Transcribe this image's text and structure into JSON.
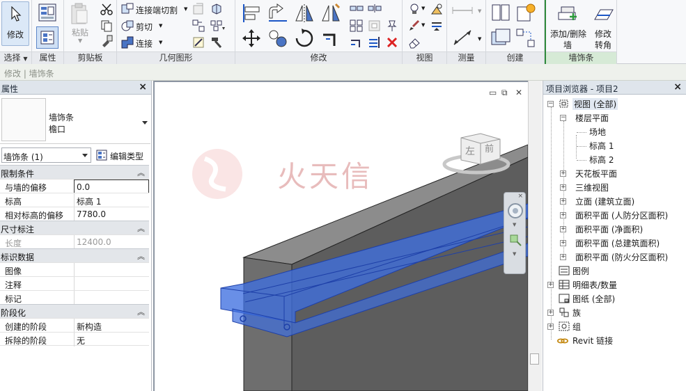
{
  "ribbon": {
    "panels": {
      "select": "选择",
      "properties": "属性",
      "clipboard": "剪贴板",
      "geometry": "几何图形",
      "modify": "修改",
      "view": "视图",
      "measure": "测量",
      "create": "创建",
      "sweep": "墙饰条"
    },
    "modify_button": "修改",
    "paste_button": "粘贴",
    "cope_label": "连接端切割",
    "cut_label": "剪切",
    "join_label": "连接",
    "add_remove_walls": [
      "添加/删除",
      "墙"
    ],
    "modify_returns": [
      "修改",
      "转角"
    ]
  },
  "modebar": {
    "text": "修改 | 墙饰条"
  },
  "properties": {
    "title": "属性",
    "type_family": "墙饰条",
    "type_name": "檐口",
    "instance_selector": "墙饰条 (1)",
    "edit_type": "编辑类型",
    "groups": [
      {
        "name": "限制条件",
        "rows": [
          {
            "key": "与墙的偏移",
            "value": "0.0"
          },
          {
            "key": "标高",
            "value": "标高 1"
          },
          {
            "key": "相对标高的偏移",
            "value": "7780.0"
          }
        ]
      },
      {
        "name": "尺寸标注",
        "rows": [
          {
            "key": "长度",
            "value": "12400.0"
          }
        ]
      },
      {
        "name": "标识数据",
        "rows": [
          {
            "key": "图像",
            "value": ""
          },
          {
            "key": "注释",
            "value": ""
          },
          {
            "key": "标记",
            "value": ""
          }
        ]
      },
      {
        "name": "阶段化",
        "rows": [
          {
            "key": "创建的阶段",
            "value": "新构造"
          },
          {
            "key": "拆除的阶段",
            "value": "无"
          }
        ]
      }
    ]
  },
  "viewport": {
    "viewcube_left": "左",
    "viewcube_front": "前",
    "watermark_text": "火天信"
  },
  "browser": {
    "title": "项目浏览器 - 项目2",
    "root": "视图 (全部)",
    "floor_plans": "楼层平面",
    "floor_plan_items": [
      "场地",
      "标高 1",
      "标高 2"
    ],
    "view_groups": [
      "天花板平面",
      "三维视图",
      "立面 (建筑立面)",
      "面积平面 (人防分区面积)",
      "面积平面 (净面积)",
      "面积平面 (总建筑面积)",
      "面积平面 (防火分区面积)"
    ],
    "top_items": [
      "图例",
      "明细表/数量",
      "图纸 (全部)",
      "族",
      "组",
      "Revit 链接"
    ]
  },
  "colors": {
    "selection_blue": "#3f6fe0",
    "wall_gray": "#6b6b6b",
    "ribbon_bg": "#f7f8fa",
    "palette_header": "#dfe5ec"
  }
}
